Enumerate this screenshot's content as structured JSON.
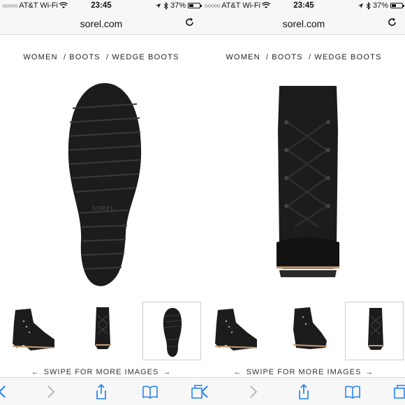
{
  "colors": {
    "accent": "#1a7ef5",
    "bar_bg": "#f7f7f7",
    "boot_black": "#1c1c1c"
  },
  "status": {
    "carrier": "AT&T Wi-Fi",
    "time": "23:45",
    "battery": "37%"
  },
  "browser": {
    "url": "sorel.com"
  },
  "breadcrumb": {
    "women": "WOMEN",
    "boots": "BOOTS",
    "wedge": "WEDGE BOOTS",
    "sep": "/"
  },
  "gallery": {
    "swipe_label": "SWIPE FOR MORE IMAGES",
    "left_main": "boot-sole-image",
    "right_main": "boot-front-image"
  },
  "toolbar": {
    "icons": [
      "back-icon",
      "forward-icon",
      "share-icon",
      "bookmarks-icon",
      "tabs-icon"
    ]
  }
}
